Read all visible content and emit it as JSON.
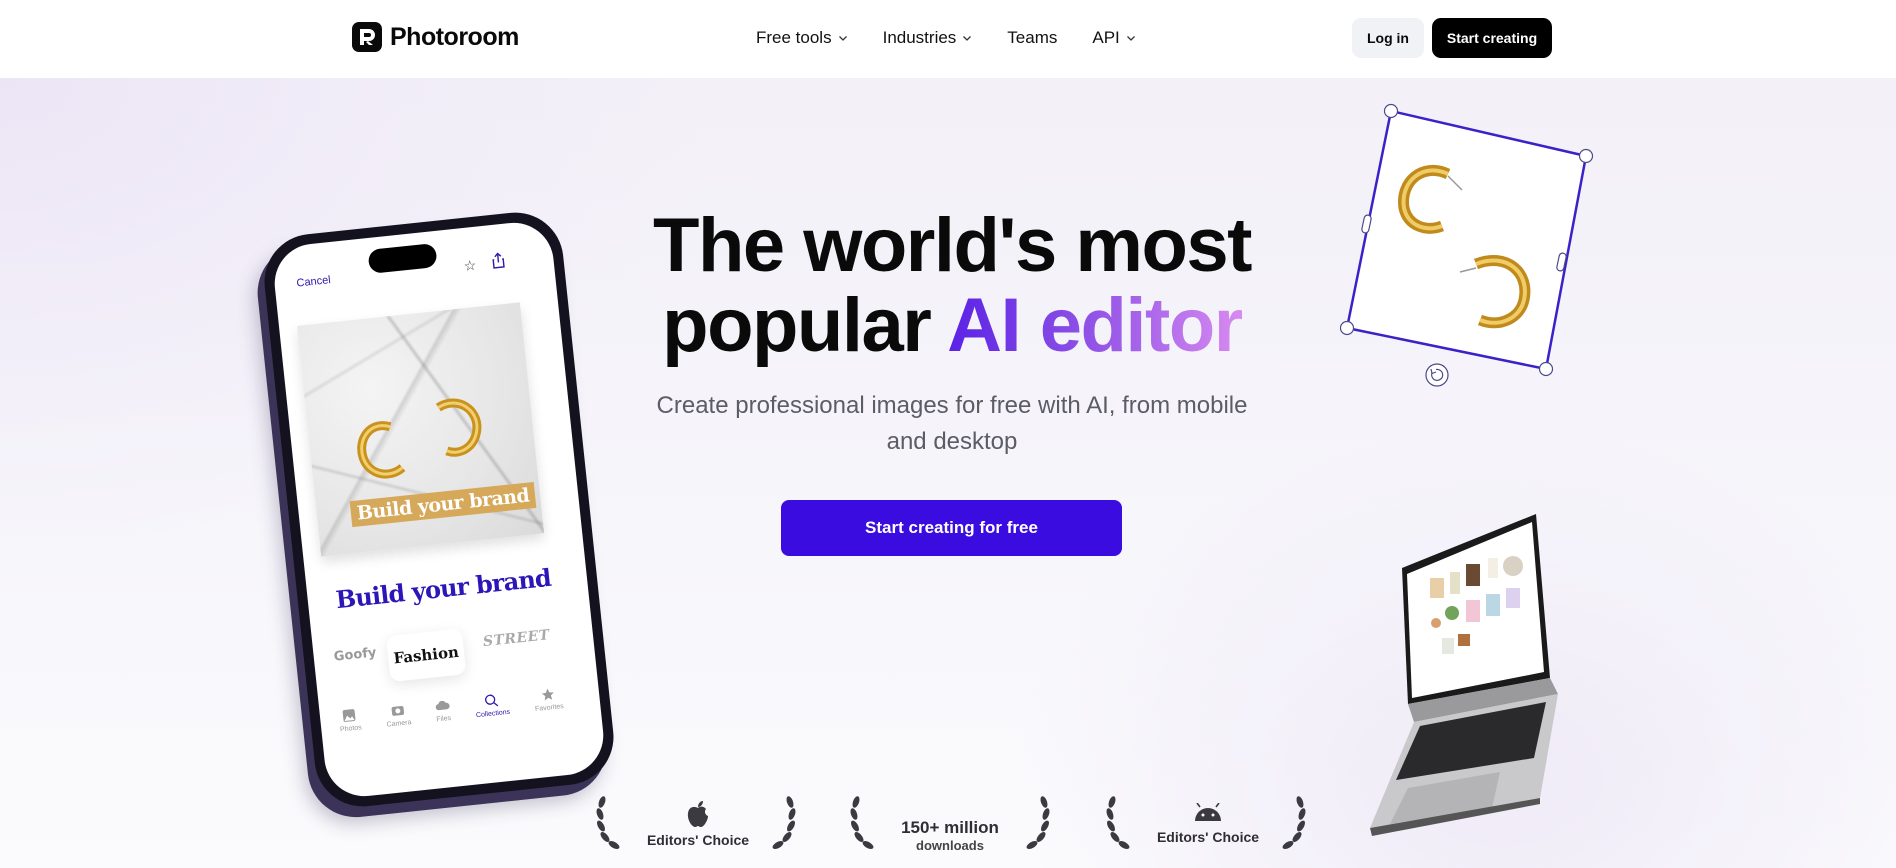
{
  "header": {
    "brand": "Photoroom",
    "nav": [
      {
        "label": "Free tools",
        "has_dropdown": true
      },
      {
        "label": "Industries",
        "has_dropdown": true
      },
      {
        "label": "Teams",
        "has_dropdown": false
      },
      {
        "label": "API",
        "has_dropdown": true
      }
    ],
    "login_label": "Log in",
    "start_label": "Start creating"
  },
  "hero": {
    "headline_line1": "The world's most",
    "headline_line2_plain": "popular",
    "headline_line2_accent": "AI editor",
    "subhead": "Create professional images for free with AI, from mobile and desktop",
    "cta_label": "Start creating for free",
    "accent_gradient": [
      "#5a22e6",
      "#8c4fe6",
      "#d78af0"
    ],
    "cta_color": "#3a0ce0"
  },
  "phone": {
    "cancel_label": "Cancel",
    "star_icon": "star-icon",
    "share_icon": "share-icon",
    "banner_text": "Build your brand",
    "title_text": "Build your brand",
    "fonts": [
      "Goofy",
      "Fashion",
      "STREET"
    ],
    "selected_font": "Fashion",
    "tabs": [
      {
        "label": "Photos",
        "icon": "photos-icon"
      },
      {
        "label": "Camera",
        "icon": "camera-icon"
      },
      {
        "label": "Files",
        "icon": "cloud-icon"
      },
      {
        "label": "Collections",
        "icon": "search-icon",
        "active": true
      },
      {
        "label": "Favorites",
        "icon": "star-icon"
      }
    ]
  },
  "awards": [
    {
      "icon": "apple-icon",
      "label": "Editors' Choice"
    },
    {
      "big": "150+ million",
      "small": "downloads"
    },
    {
      "icon": "android-icon",
      "label": "Editors' Choice"
    }
  ]
}
